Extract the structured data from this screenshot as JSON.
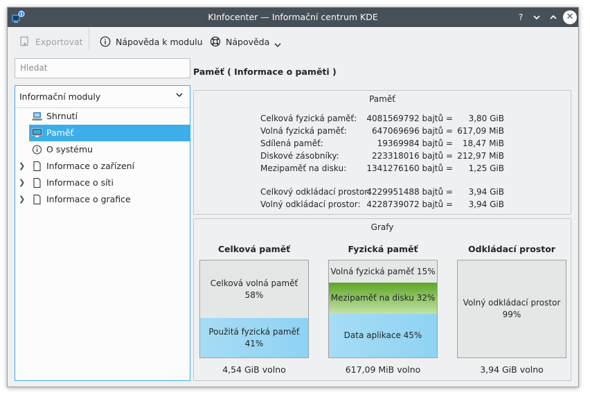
{
  "window": {
    "title": "KInfocenter — Informační centrum KDE",
    "buttons": {
      "help": "?",
      "minimize": "⌄",
      "maximize": "⌃",
      "close": "✕"
    }
  },
  "toolbar": {
    "export_label": "Exportovat",
    "module_help_label": "Nápověda k modulu",
    "help_label": "Nápověda"
  },
  "search": {
    "placeholder": "Hledat"
  },
  "sidebar": {
    "header": "Informační moduly",
    "items": [
      {
        "label": "Shrnutí",
        "icon": "computer-icon",
        "expandable": false,
        "selected": false
      },
      {
        "label": "Paměť",
        "icon": "monitor-icon",
        "expandable": false,
        "selected": true
      },
      {
        "label": "O systému",
        "icon": "info-icon",
        "expandable": false,
        "selected": false
      },
      {
        "label": "Informace o zařízení",
        "icon": "document-icon",
        "expandable": true,
        "selected": false
      },
      {
        "label": "Informace o síti",
        "icon": "document-icon",
        "expandable": true,
        "selected": false
      },
      {
        "label": "Informace o grafice",
        "icon": "document-icon",
        "expandable": true,
        "selected": false
      }
    ]
  },
  "module": {
    "title": "Paměť  ( Informace o paměti )"
  },
  "memory": {
    "title": "Paměť",
    "rows": [
      {
        "label": "Celková fyzická paměť:",
        "bytes": "4081569792 bajtů =",
        "human": "3,80 GiB"
      },
      {
        "label": "Volná fyzická paměť:",
        "bytes": "647069696 bajtů =",
        "human": "617,09 MiB"
      },
      {
        "label": "Sdílená paměť:",
        "bytes": "19369984 bajtů =",
        "human": "18,47 MiB"
      },
      {
        "label": "Diskové zásobníky:",
        "bytes": "223318016 bajtů =",
        "human": "212,97 MiB"
      },
      {
        "label": "Mezipaměť na disku:",
        "bytes": "1341276160 bajtů =",
        "human": "1,25 GiB"
      }
    ],
    "swap_rows": [
      {
        "label": "Celkový odkládací prostor:",
        "bytes": "4229951488 bajtů =",
        "human": "3,94 GiB"
      },
      {
        "label": "Volný odkládací prostor:",
        "bytes": "4228739072 bajtů =",
        "human": "3,94 GiB"
      }
    ]
  },
  "graphs": {
    "title": "Grafy",
    "colors": {
      "free": "#e3e8e6",
      "used_top": "#a6dcf5",
      "used_bottom": "#8fd3f3",
      "cache_top": "#5ea528",
      "cache_bottom": "#c3e3a6"
    },
    "charts": [
      {
        "title": "Celková paměť",
        "footer": "4,54 GiB volno",
        "segments": [
          {
            "label": "Celková volná paměť 58%",
            "percent": 58,
            "kind": "free"
          },
          {
            "label": "Použitá fyzická paměť 41%",
            "percent": 41,
            "kind": "used"
          }
        ]
      },
      {
        "title": "Fyzická paměť",
        "footer": "617,09 MiB volno",
        "segments": [
          {
            "label": "Volná fyzická paměť 15%",
            "percent": 15,
            "kind": "free"
          },
          {
            "label": "Mezipaměť na disku 32%",
            "percent": 32,
            "kind": "cache"
          },
          {
            "label": "Data aplikace 45%",
            "percent": 45,
            "kind": "used"
          }
        ]
      },
      {
        "title": "Odkládací prostor",
        "footer": "3,94 GiB volno",
        "segments": [
          {
            "label": "Volný odkládací prostor 99%",
            "percent": 99,
            "kind": "free"
          }
        ]
      }
    ]
  }
}
